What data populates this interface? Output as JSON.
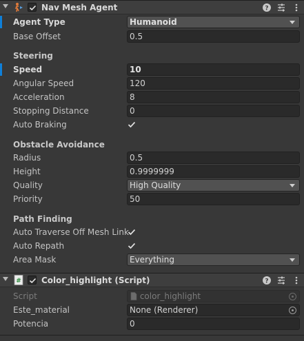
{
  "nav_mesh_agent": {
    "title": "Nav Mesh Agent",
    "icon": "nav-mesh-agent-icon",
    "enabled": true,
    "agent_type": {
      "label": "Agent Type",
      "value": "Humanoid"
    },
    "base_offset": {
      "label": "Base Offset",
      "value": "0.5"
    },
    "steering": {
      "header": "Steering",
      "speed": {
        "label": "Speed",
        "value": "10"
      },
      "angular_speed": {
        "label": "Angular Speed",
        "value": "120"
      },
      "acceleration": {
        "label": "Acceleration",
        "value": "8"
      },
      "stopping_distance": {
        "label": "Stopping Distance",
        "value": "0"
      },
      "auto_braking": {
        "label": "Auto Braking",
        "checked": true
      }
    },
    "obstacle_avoidance": {
      "header": "Obstacle Avoidance",
      "radius": {
        "label": "Radius",
        "value": "0.5"
      },
      "height": {
        "label": "Height",
        "value": "0.9999999"
      },
      "quality": {
        "label": "Quality",
        "value": "High Quality"
      },
      "priority": {
        "label": "Priority",
        "value": "50"
      }
    },
    "path_finding": {
      "header": "Path Finding",
      "auto_traverse": {
        "label": "Auto Traverse Off Mesh Link",
        "checked": true
      },
      "auto_repath": {
        "label": "Auto Repath",
        "checked": true
      },
      "area_mask": {
        "label": "Area Mask",
        "value": "Everything"
      }
    }
  },
  "color_highlight": {
    "title": "Color_highlight (Script)",
    "icon": "csharp-script-icon",
    "enabled": true,
    "script": {
      "label": "Script",
      "value": "color_highlight"
    },
    "este_material": {
      "label": "Este_material",
      "value": "None (Renderer)"
    },
    "potencia": {
      "label": "Potencia",
      "value": "0"
    }
  },
  "colors": {
    "panel_bg": "#383838",
    "field_bg": "#2a2a2a",
    "dropdown_bg": "#515151",
    "accent_blue": "#0f80d9"
  }
}
